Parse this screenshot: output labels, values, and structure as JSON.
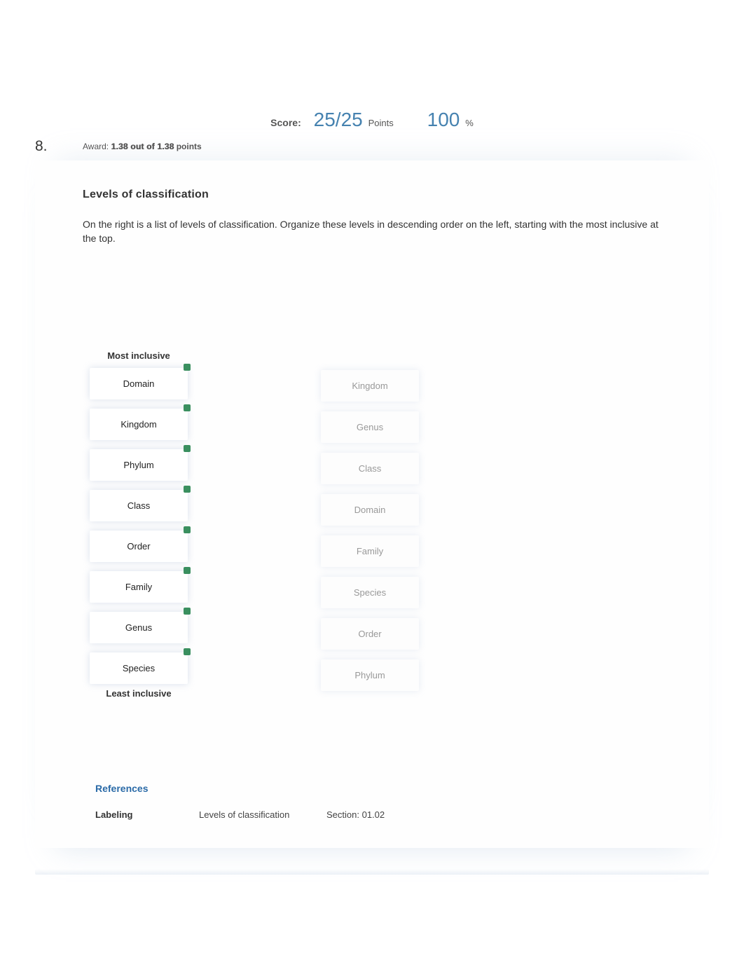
{
  "score": {
    "label": "Score:",
    "value": "25/25",
    "points_unit": "Points",
    "percent": "100",
    "percent_unit": "%"
  },
  "question": {
    "number": "8.",
    "award_prefix": "Award:",
    "award_value": "1.38 out of 1.38",
    "award_suffix": " points",
    "title": "Levels of classification",
    "prompt": "On the right is a list of levels of classification. Organize these levels in descending order on the left, starting with the most inclusive at the top."
  },
  "boards": {
    "top_label": "Most inclusive",
    "bottom_label": "Least inclusive",
    "answers": [
      "Domain",
      "Kingdom",
      "Phylum",
      "Class",
      "Order",
      "Family",
      "Genus",
      "Species"
    ],
    "choices": [
      "Kingdom",
      "Genus",
      "Class",
      "Domain",
      "Family",
      "Species",
      "Order",
      "Phylum"
    ]
  },
  "references": {
    "title": "References",
    "type_label": "Labeling",
    "topic": "Levels of classification",
    "section": "Section: 01.02"
  }
}
